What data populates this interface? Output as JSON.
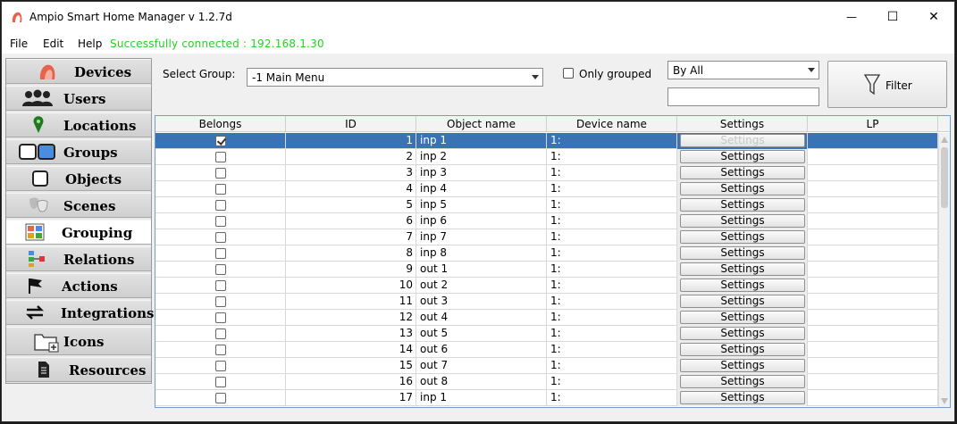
{
  "window": {
    "title": "Ampio Smart Home Manager v 1.2.7d",
    "minimize_glyph": "—",
    "maximize_glyph": "☐",
    "close_glyph": "✕"
  },
  "menu": {
    "file": "File",
    "edit": "Edit",
    "help": "Help",
    "status": "Successfully connected : 192.168.1.30"
  },
  "sidebar": {
    "items": [
      {
        "label": "Devices",
        "icon": "devices-icon"
      },
      {
        "label": "Users",
        "icon": "users-icon"
      },
      {
        "label": "Locations",
        "icon": "location-pin-icon"
      },
      {
        "label": "Groups",
        "icon": "groups-icon"
      },
      {
        "label": "Objects",
        "icon": "objects-icon"
      },
      {
        "label": "Scenes",
        "icon": "scenes-masks-icon"
      },
      {
        "label": "Grouping",
        "icon": "grouping-icon"
      },
      {
        "label": "Relations",
        "icon": "relations-icon"
      },
      {
        "label": "Actions",
        "icon": "flag-icon"
      },
      {
        "label": "Integrations",
        "icon": "swap-arrows-icon"
      },
      {
        "label": "Icons",
        "icon": "folder-add-icon"
      },
      {
        "label": "Resources",
        "icon": "document-icon"
      }
    ],
    "active": "Grouping"
  },
  "filters": {
    "select_group_label": "Select Group:",
    "select_group_value": "-1 Main Menu",
    "only_grouped_label": "Only grouped",
    "only_grouped_checked": false,
    "by_all_value": "By All",
    "search_value": "",
    "filter_button": "Filter"
  },
  "table": {
    "columns": [
      "Belongs",
      "ID",
      "Object name",
      "Device name",
      "Settings",
      "LP"
    ],
    "settings_label": "Settings",
    "rows": [
      {
        "belongs": true,
        "id": "1",
        "object": "inp 1",
        "device": "1:",
        "lp": "",
        "selected": true
      },
      {
        "belongs": false,
        "id": "2",
        "object": "inp 2",
        "device": "1:",
        "lp": ""
      },
      {
        "belongs": false,
        "id": "3",
        "object": "inp 3",
        "device": "1:",
        "lp": ""
      },
      {
        "belongs": false,
        "id": "4",
        "object": "inp 4",
        "device": "1:",
        "lp": ""
      },
      {
        "belongs": false,
        "id": "5",
        "object": "inp 5",
        "device": "1:",
        "lp": ""
      },
      {
        "belongs": false,
        "id": "6",
        "object": "inp 6",
        "device": "1:",
        "lp": ""
      },
      {
        "belongs": false,
        "id": "7",
        "object": "inp 7",
        "device": "1:",
        "lp": ""
      },
      {
        "belongs": false,
        "id": "8",
        "object": "inp 8",
        "device": "1:",
        "lp": ""
      },
      {
        "belongs": false,
        "id": "9",
        "object": "out 1",
        "device": "1:",
        "lp": ""
      },
      {
        "belongs": false,
        "id": "10",
        "object": "out 2",
        "device": "1:",
        "lp": ""
      },
      {
        "belongs": false,
        "id": "11",
        "object": "out 3",
        "device": "1:",
        "lp": ""
      },
      {
        "belongs": false,
        "id": "12",
        "object": "out 4",
        "device": "1:",
        "lp": ""
      },
      {
        "belongs": false,
        "id": "13",
        "object": "out 5",
        "device": "1:",
        "lp": ""
      },
      {
        "belongs": false,
        "id": "14",
        "object": "out 6",
        "device": "1:",
        "lp": ""
      },
      {
        "belongs": false,
        "id": "15",
        "object": "out 7",
        "device": "1:",
        "lp": ""
      },
      {
        "belongs": false,
        "id": "16",
        "object": "out 8",
        "device": "1:",
        "lp": ""
      },
      {
        "belongs": false,
        "id": "17",
        "object": "inp 1",
        "device": "1:",
        "lp": ""
      }
    ]
  },
  "colors": {
    "status_green": "#22d322",
    "selection_blue": "#3a73b5",
    "table_border": "#6e9fd0"
  }
}
